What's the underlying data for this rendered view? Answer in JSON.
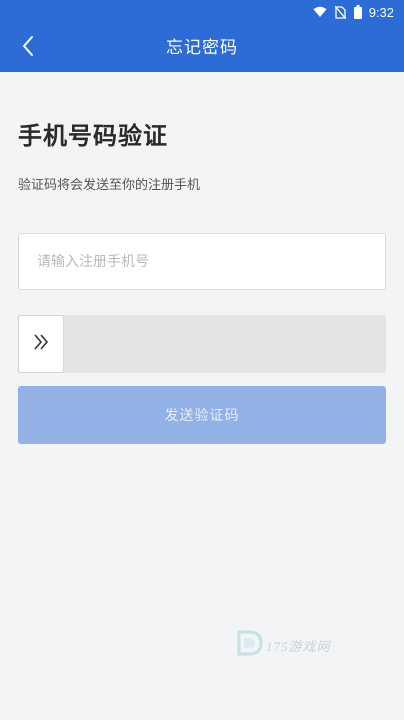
{
  "status_bar": {
    "time": "9:32",
    "icons": [
      "wifi-icon",
      "no-sim-icon",
      "battery-icon"
    ]
  },
  "nav": {
    "title": "忘记密码",
    "back_icon": "chevron-left-icon"
  },
  "page": {
    "heading": "手机号码验证",
    "subtext": "验证码将会发送至你的注册手机"
  },
  "phone_field": {
    "value": "",
    "placeholder": "请输入注册手机号"
  },
  "slider": {
    "handle_icon": "double-chevron-right-icon",
    "progress": 0
  },
  "send_button": {
    "label": "发送验证码"
  },
  "watermark": {
    "text": "175游戏网",
    "icon": "d-logo-icon"
  },
  "colors": {
    "primary": "#2d6bd6",
    "button_disabled": "#92b1e6",
    "background": "#f3f4f6",
    "slider_track": "#e3e4e6"
  }
}
